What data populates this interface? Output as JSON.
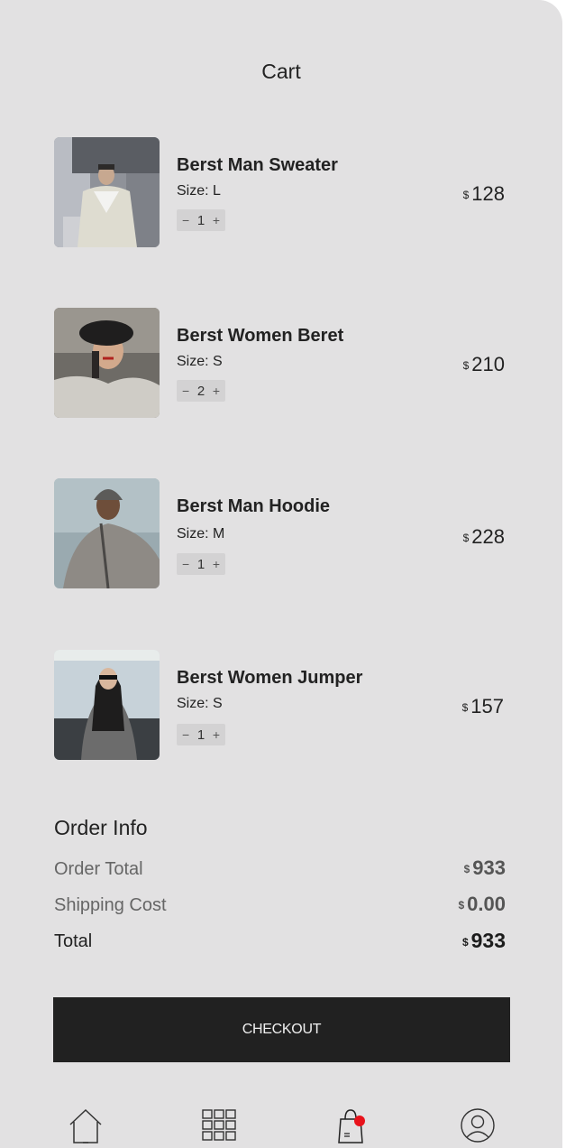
{
  "header": {
    "title": "Cart"
  },
  "cart": {
    "size_label": "Size:",
    "items": [
      {
        "name": "Berst Man Sweater",
        "size": "L",
        "qty": "1",
        "currency": "$",
        "price": "128",
        "minus": "−",
        "plus": "+"
      },
      {
        "name": "Berst Women Beret",
        "size": "S",
        "qty": "2",
        "currency": "$",
        "price": "210",
        "minus": "−",
        "plus": "+"
      },
      {
        "name": "Berst Man Hoodie",
        "size": "M",
        "qty": "1",
        "currency": "$",
        "price": "228",
        "minus": "−",
        "plus": "+"
      },
      {
        "name": "Berst Women Jumper",
        "size": "S",
        "qty": "1",
        "currency": "$",
        "price": "157",
        "minus": "−",
        "plus": "+"
      }
    ]
  },
  "order_info": {
    "title": "Order Info",
    "order_total_label": "Order Total",
    "order_total_currency": "$",
    "order_total_value": "933",
    "shipping_label": "Shipping Cost",
    "shipping_currency": "$",
    "shipping_value": "0.00",
    "total_label": "Total",
    "total_currency": "$",
    "total_value": "933"
  },
  "checkout": {
    "label": "CHECKOUT"
  },
  "tabbar": {
    "items": [
      "home-icon",
      "grid-icon",
      "shopping-bag-icon",
      "profile-icon"
    ],
    "badge_color": "#e8121b"
  },
  "colors": {
    "background": "#e2e1e2",
    "button": "#212121",
    "stepper": "#d3d2d3"
  }
}
